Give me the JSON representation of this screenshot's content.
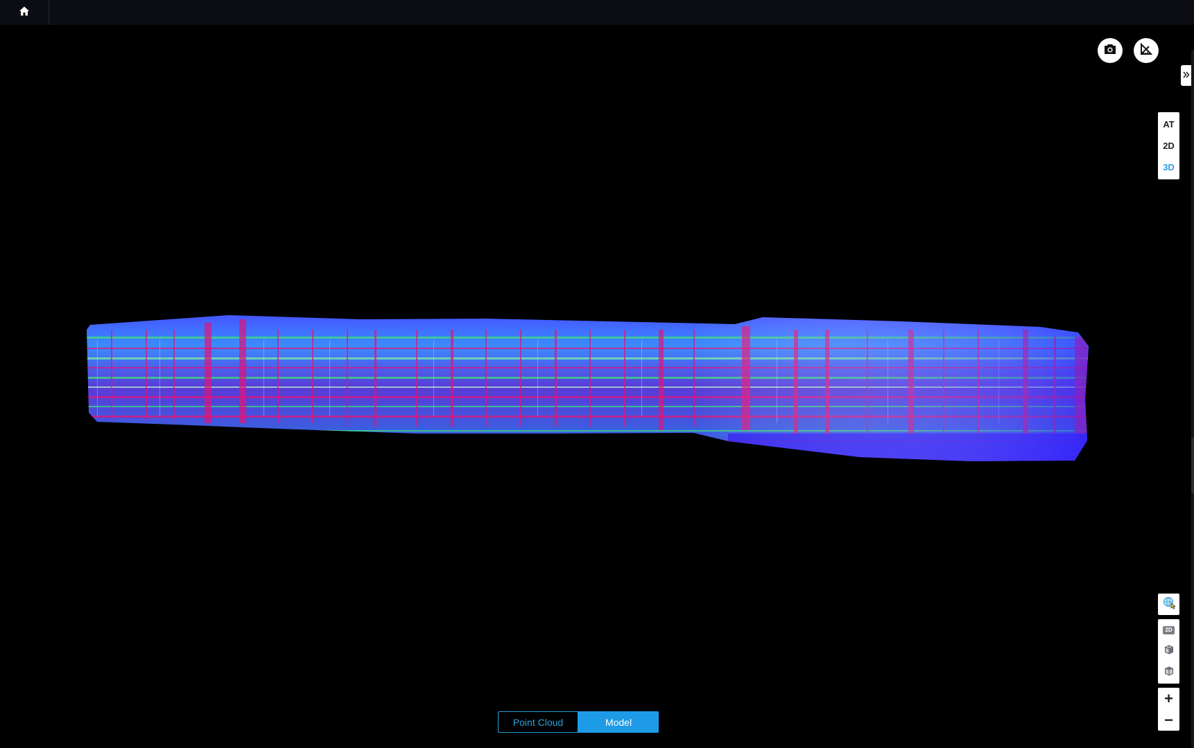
{
  "topbar": {
    "home_icon": "home-icon"
  },
  "tools": {
    "screenshot_icon": "camera-icon",
    "measure_icon": "ruler-triangle-icon",
    "collapse_icon": "double-chevron-right-icon"
  },
  "view_modes": [
    {
      "label": "AT",
      "active": false
    },
    {
      "label": "2D",
      "active": false
    },
    {
      "label": "3D",
      "active": true
    }
  ],
  "bottom_controls": {
    "layers_icon": "globe-layers-icon",
    "view_2d_label": "2D",
    "view_2d_icon": "map-2d-icon",
    "view_side_icon": "cube-side-icon",
    "view_iso_icon": "cube-iso-icon",
    "zoom_in_label": "+",
    "zoom_out_label": "−"
  },
  "render_toggle": {
    "point_cloud_label": "Point Cloud",
    "model_label": "Model",
    "selected": "Model"
  },
  "colors": {
    "accent": "#1e9be6",
    "topbar_bg": "#0c0d14",
    "viewport_bg": "#000000",
    "model_blue": "#3a35ff",
    "model_magenta": "#e0157a",
    "model_green": "#3de07a"
  }
}
